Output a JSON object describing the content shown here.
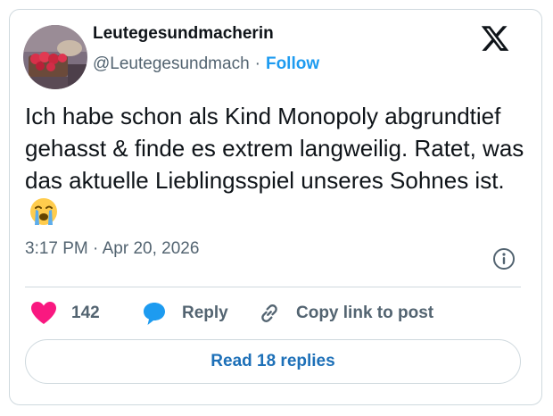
{
  "author": {
    "display_name": "Leutegesundmacherin",
    "handle": "@Leutegesundmach",
    "separator": "·",
    "follow_label": "Follow"
  },
  "tweet": {
    "text": "Ich habe schon als Kind Monopoly abgrundtief gehasst & finde es extrem langweilig. Ratet, was das aktuelle Lieblingsspiel unseres Sohnes ist.",
    "emoji": "loudly-crying-face-emoji",
    "timestamp": "3:17 PM · Apr 20, 2026"
  },
  "actions": {
    "like_count": "142",
    "reply_label": "Reply",
    "copy_label": "Copy link to post"
  },
  "footer": {
    "read_replies_label": "Read 18 replies"
  },
  "icons": {
    "logo": "x-logo-icon",
    "info": "info-icon",
    "like": "heart-icon",
    "reply": "speech-bubble-icon",
    "copy": "link-icon"
  },
  "colors": {
    "accent": "#1d9bf0",
    "like": "#f91880",
    "text": "#0f1419",
    "muted": "#536471",
    "border": "#cfd9de"
  }
}
